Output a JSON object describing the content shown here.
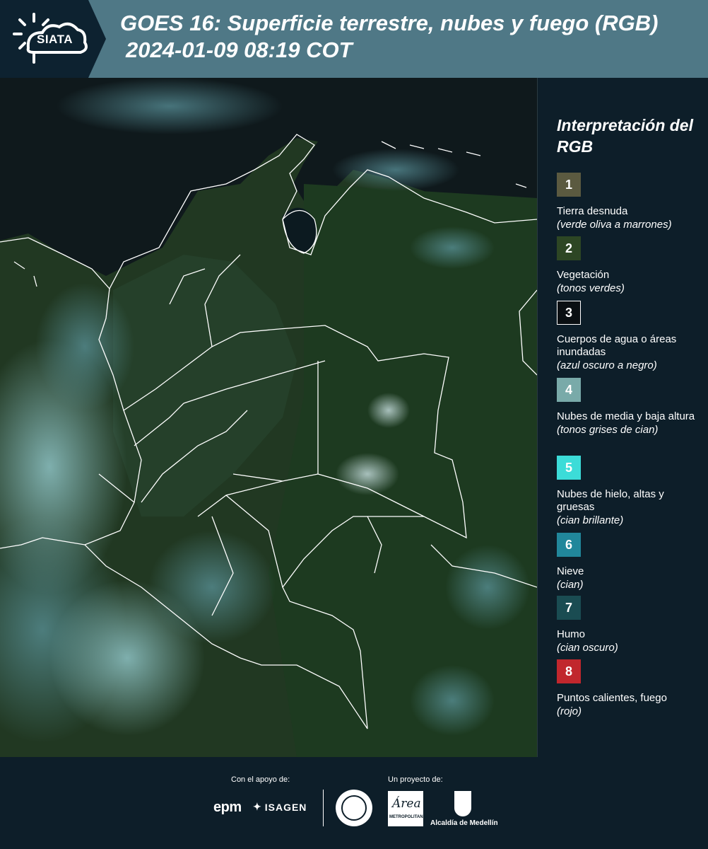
{
  "header": {
    "logo_text": "SIATA",
    "title_line1": "GOES 16: Superficie terrestre, nubes y fuego (RGB)",
    "title_line2": "2024-01-09 08:19 COT"
  },
  "map": {
    "content": "satellite-image-goes16-colombia"
  },
  "legend": {
    "title": "Interpretación del RGB",
    "items": [
      {
        "number": "1",
        "label": "Tierra desnuda",
        "note": "(verde oliva a marrones)",
        "color": "#5b5a40"
      },
      {
        "number": "2",
        "label": "Vegetación",
        "note": "(tonos verdes)",
        "color": "#2d4624"
      },
      {
        "number": "3",
        "label": "Cuerpos de agua o áreas inundadas",
        "note": "(azul oscuro a negro)",
        "color": "#0a0f12"
      },
      {
        "number": "4",
        "label": "Nubes de media y baja altura",
        "note": "(tonos grises de cian)",
        "color": "#79aaa9"
      },
      {
        "number": "5",
        "label": "Nubes de hielo, altas y gruesas",
        "note": "(cian brillante)",
        "color": "#3cdcd8"
      },
      {
        "number": "6",
        "label": "Nieve",
        "note": "(cian)",
        "color": "#21879b"
      },
      {
        "number": "7",
        "label": "Humo",
        "note": "(cian oscuro)",
        "color": "#1a4c52"
      },
      {
        "number": "8",
        "label": "Puntos calientes, fuego",
        "note": "(rojo)",
        "color": "#c1272d"
      }
    ]
  },
  "footer": {
    "support_label": "Con el apoyo de:",
    "project_label": "Un proyecto de:",
    "sponsor_epm": "epm",
    "sponsor_isagen": "ISAGEN",
    "area_sig": "Área",
    "area_sub": "METROPOLITANA",
    "alcaldia": "Alcaldía de Medellín"
  }
}
